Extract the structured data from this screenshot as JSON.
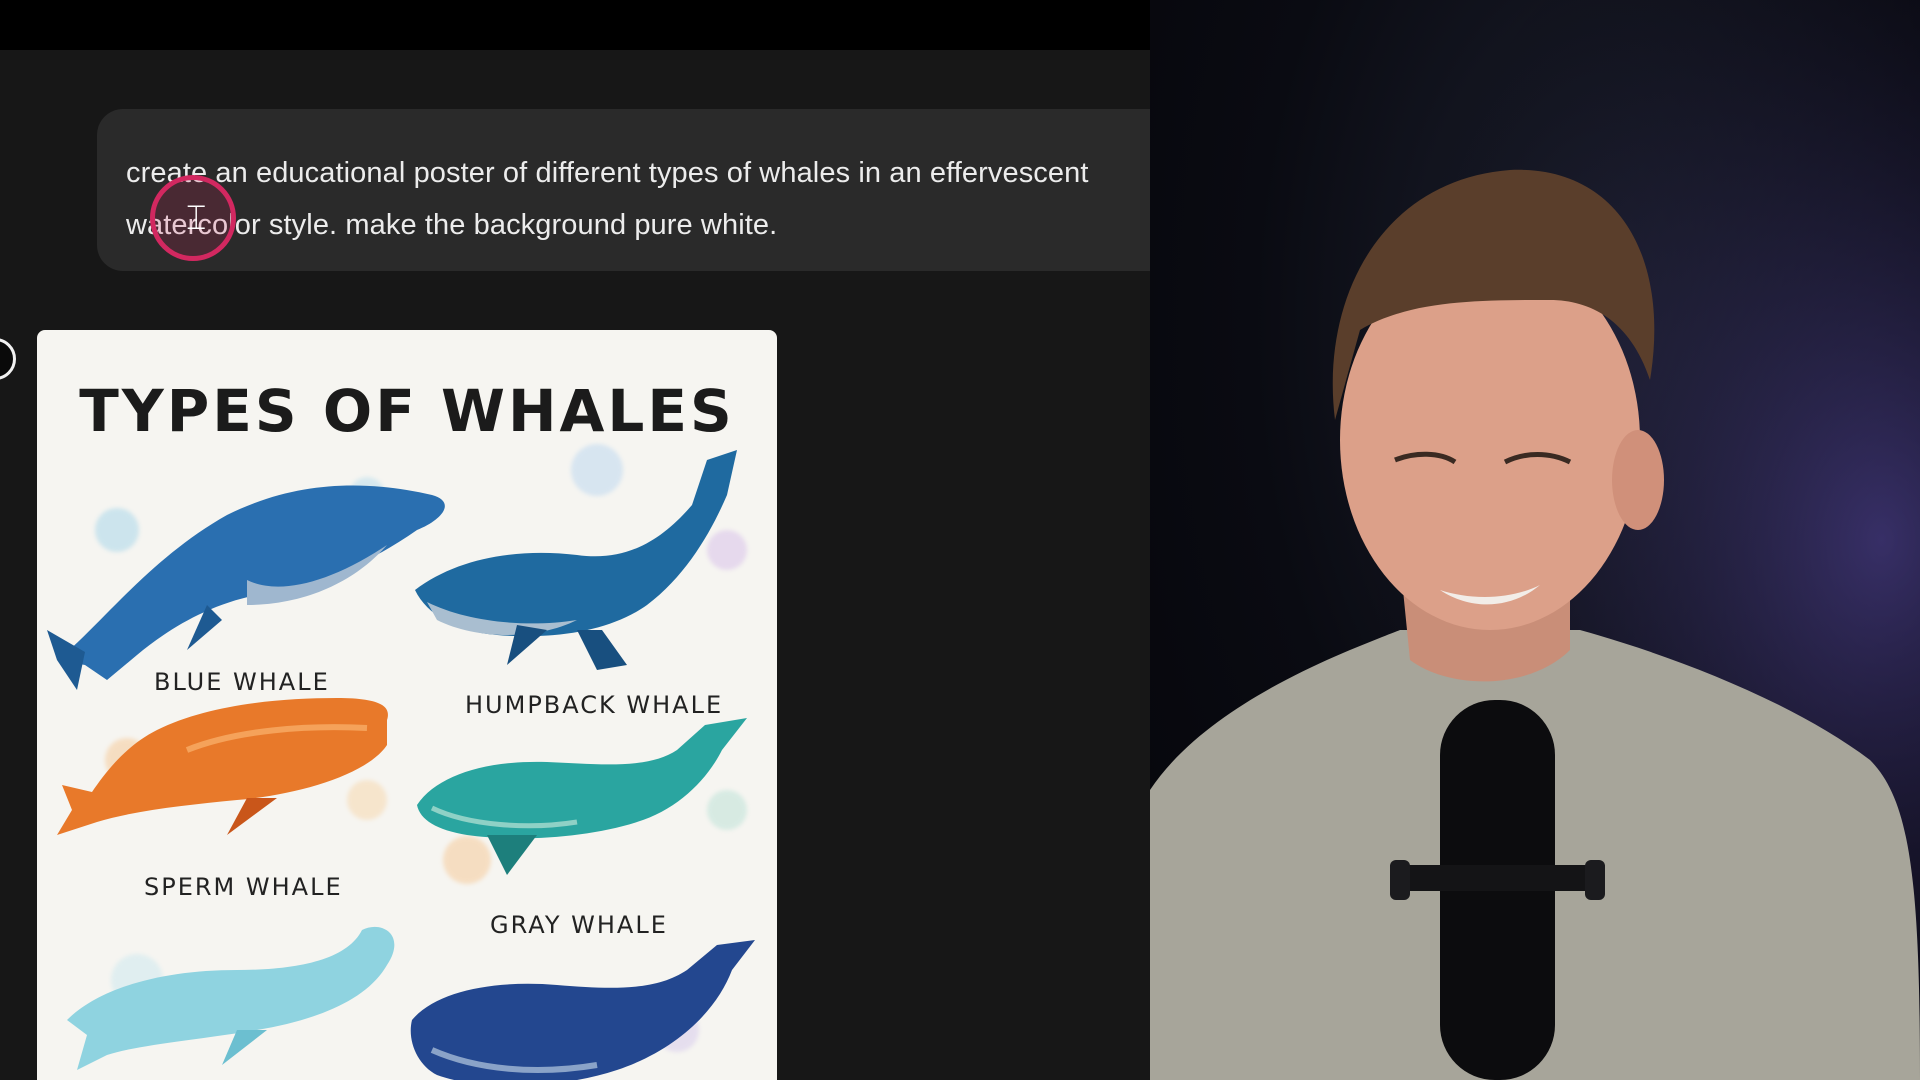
{
  "chat": {
    "prompt_text": "create an educational poster of different types of whales in an effervescent\nwatercolor style. make the background pure white."
  },
  "poster": {
    "title": "TYPES OF WHALES",
    "labels": {
      "blue": "BLUE WHALE",
      "humpback": "HUMPBACK WHALE",
      "sperm": "SPERM WHALE",
      "gray": "GRAY WHALE"
    },
    "colors": {
      "blue_whale": "#2a6fb0",
      "humpback": "#1f6aa0",
      "sperm": "#e8792a",
      "gray": "#2aa5a0",
      "beluga": "#8fd3e0",
      "bottom_right": "#23478f"
    }
  },
  "icons": {
    "cursor": "text-cursor-icon"
  }
}
